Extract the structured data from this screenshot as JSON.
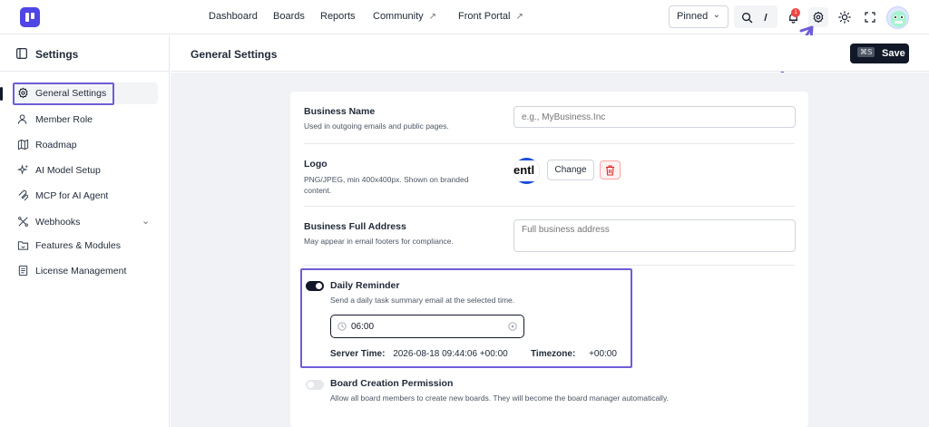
{
  "topnav": {
    "links": [
      {
        "label": "Dashboard",
        "external": false
      },
      {
        "label": "Boards",
        "external": false
      },
      {
        "label": "Reports",
        "external": false
      },
      {
        "label": "Community",
        "external": true
      },
      {
        "label": "Front Portal",
        "external": true
      }
    ],
    "pinned_label": "Pinned",
    "notification_count": "1",
    "icons": [
      "search-icon",
      "slash-shortcut-icon",
      "bell-icon",
      "gear-icon",
      "sun-icon",
      "fullscreen-icon"
    ]
  },
  "sidebar": {
    "title": "Settings",
    "items": [
      {
        "label": "General Settings",
        "icon": "gear-icon",
        "active": true
      },
      {
        "label": "Member Role",
        "icon": "users-icon"
      },
      {
        "label": "Roadmap",
        "icon": "map-icon"
      },
      {
        "label": "AI Model Setup",
        "icon": "sparkle-icon"
      },
      {
        "label": "MCP for AI Agent",
        "icon": "mcp-icon"
      },
      {
        "label": "Webhooks",
        "icon": "webhook-icon",
        "expandable": true
      },
      {
        "label": "Features & Modules",
        "icon": "folder-icon"
      },
      {
        "label": "License Management",
        "icon": "document-icon"
      }
    ]
  },
  "main": {
    "title": "General Settings",
    "save_shortcut": "⌘S",
    "save_label": "Save",
    "business_name": {
      "label": "Business Name",
      "help": "Used in outgoing emails and public pages.",
      "placeholder": "e.g., MyBusiness.Inc",
      "value": ""
    },
    "logo": {
      "label": "Logo",
      "help_line1": "PNG/JPEG, min 400x400px. Shown on branded",
      "help_line2": "content.",
      "preview_text": "entl",
      "change_label": "Change"
    },
    "address": {
      "label": "Business Full Address",
      "help": "May appear in email footers for compliance.",
      "placeholder": "Full business address"
    },
    "daily_reminder": {
      "label": "Daily Reminder",
      "enabled": true,
      "help": "Send a daily task summary email at the selected time.",
      "time_value": "06:00",
      "server_time_label": "Server Time:",
      "server_time_value": "2026-08-18 09:44:06 +00:00",
      "timezone_label": "Timezone:",
      "timezone_value": "+00:00"
    },
    "board_permission": {
      "label": "Board Creation Permission",
      "enabled": false,
      "help": "Allow all board members to create new boards. They will become the board manager automatically."
    }
  },
  "colors": {
    "accent": "#4f46e5",
    "annotation": "#6d5dd8",
    "dark": "#111827",
    "danger": "#ef4444"
  }
}
